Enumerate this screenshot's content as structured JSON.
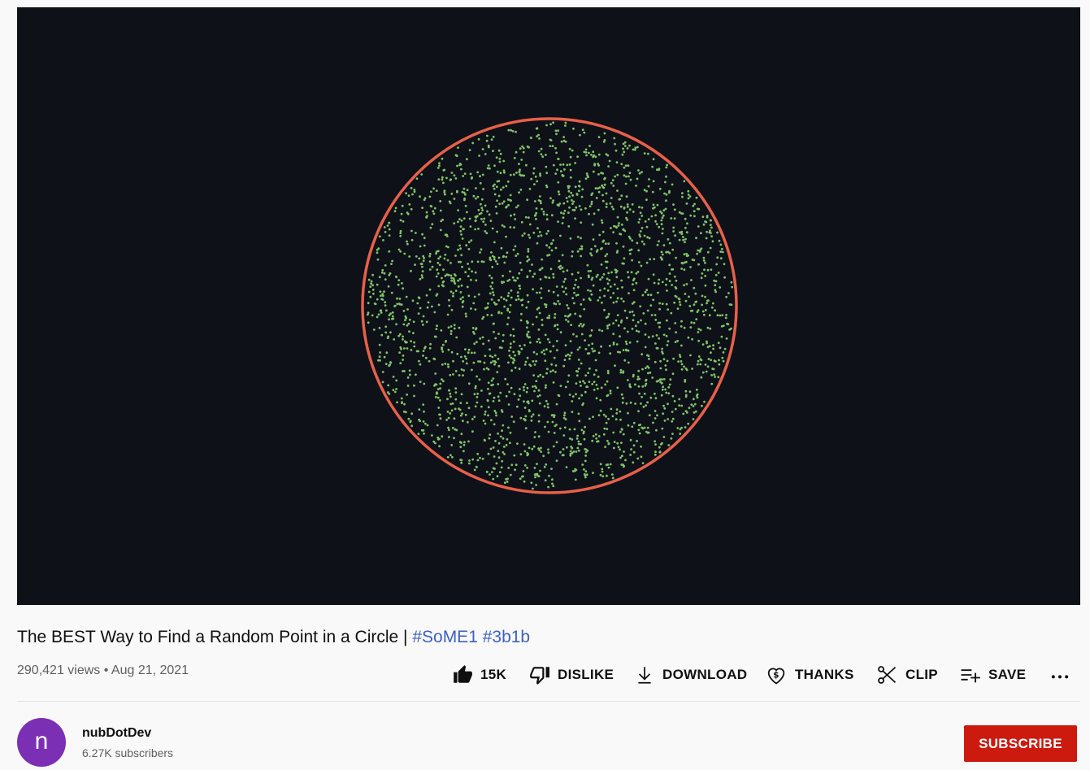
{
  "video": {
    "title_main": "The BEST Way to Find a Random Point in a Circle | ",
    "hashtags": [
      "#SoME1",
      "#3b1b"
    ],
    "views": "290,421 views",
    "separator": " • ",
    "date": "Aug 21, 2021",
    "colors": {
      "background": "#0e1118",
      "circle_stroke": "#e8604a",
      "points": "#7fc36a"
    },
    "point_count": 2400
  },
  "actions": {
    "like": {
      "icon": "thumbs-up-icon",
      "label": "15K"
    },
    "dislike": {
      "icon": "thumbs-down-icon",
      "label": "DISLIKE"
    },
    "download": {
      "icon": "download-icon",
      "label": "DOWNLOAD"
    },
    "thanks": {
      "icon": "heart-dollar-icon",
      "label": "THANKS"
    },
    "clip": {
      "icon": "scissors-icon",
      "label": "CLIP"
    },
    "save": {
      "icon": "playlist-add-icon",
      "label": "SAVE"
    },
    "more": {
      "icon": "more-horizontal-icon",
      "label": "…"
    }
  },
  "channel": {
    "avatar_letter": "n",
    "avatar_color": "#7b2fb5",
    "name": "nubDotDev",
    "subscribers": "6.27K subscribers"
  },
  "subscribe": {
    "label": "SUBSCRIBE",
    "color": "#cc1a0e"
  }
}
